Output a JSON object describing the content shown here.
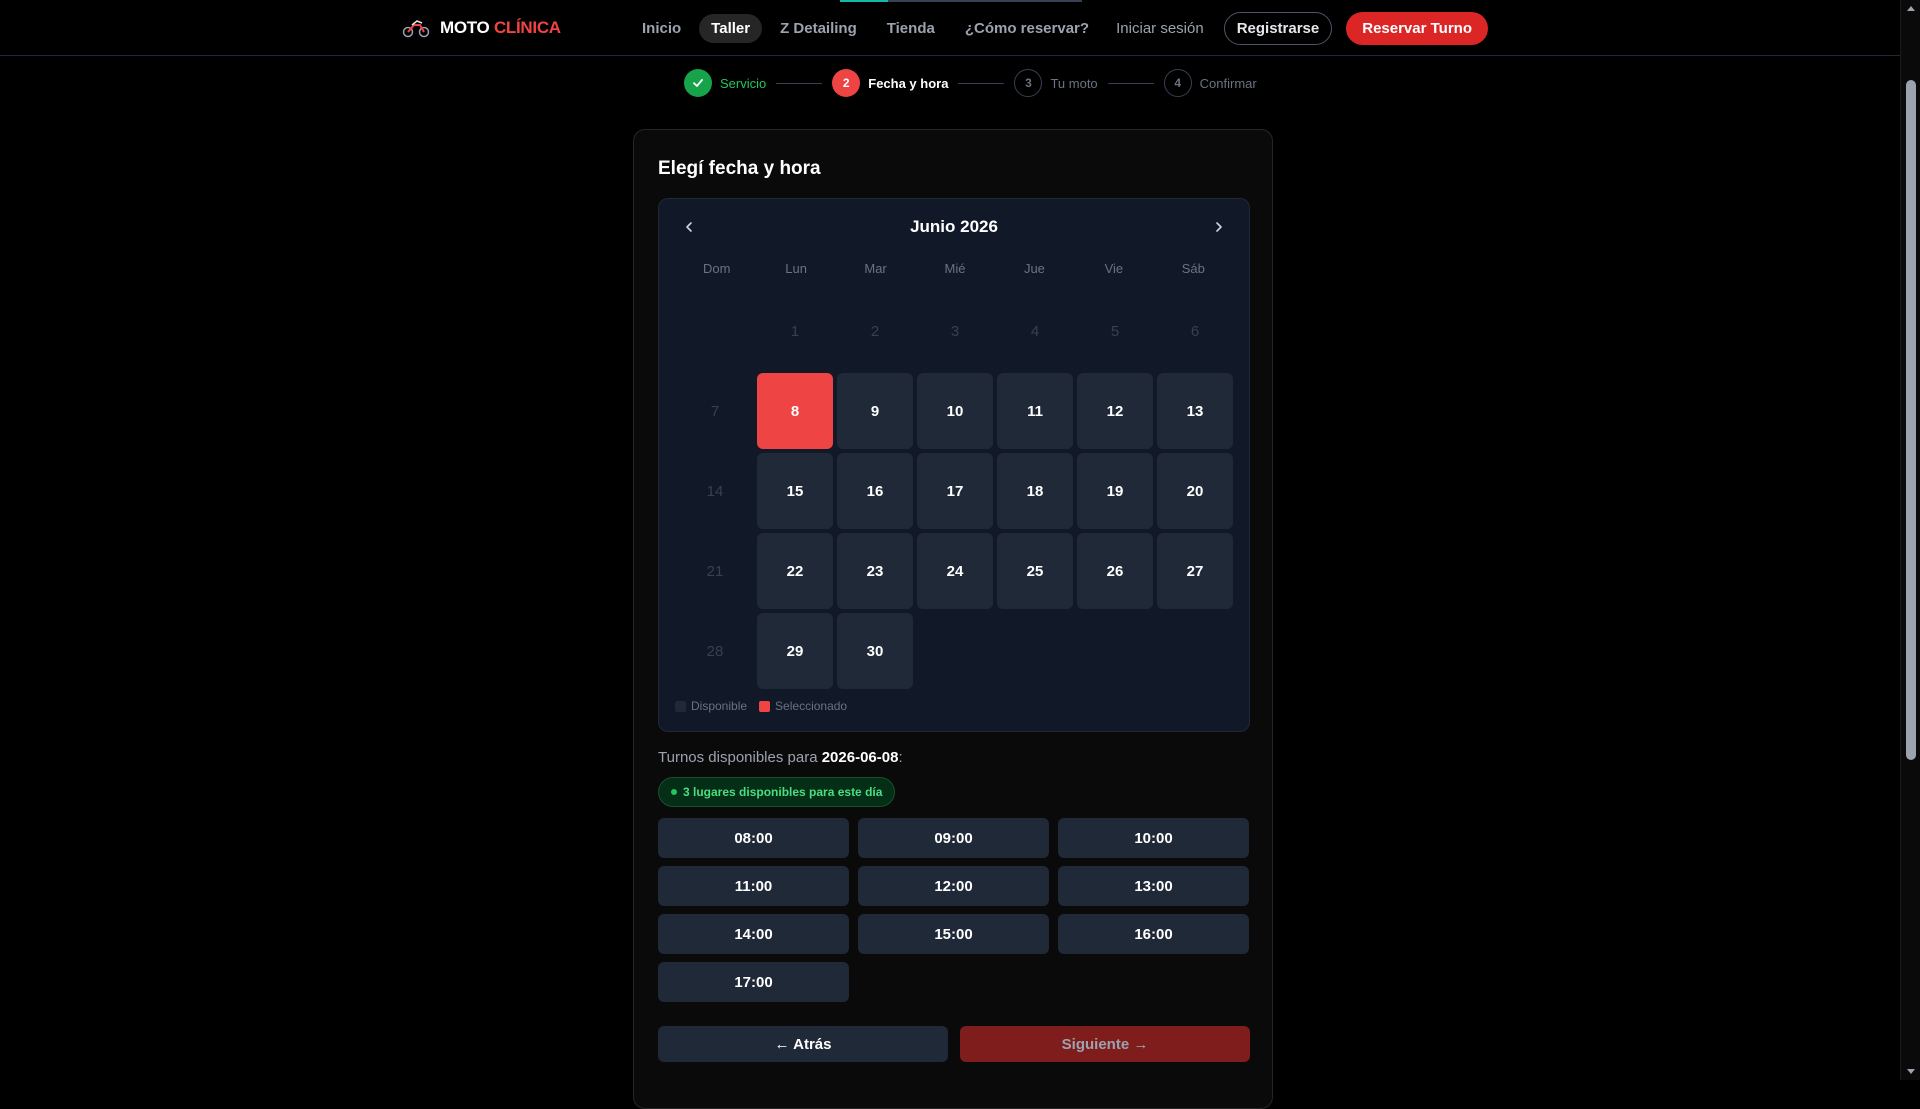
{
  "navbar": {
    "brand_part1": "MOTO",
    "brand_part2": "CLÍNICA",
    "links": [
      {
        "label": "Inicio",
        "active": false
      },
      {
        "label": "Taller",
        "active": true
      },
      {
        "label": "Z Detailing",
        "active": false
      },
      {
        "label": "Tienda",
        "active": false
      },
      {
        "label": "¿Cómo reservar?",
        "active": false
      }
    ],
    "login": "Iniciar sesión",
    "register": "Registrarse",
    "book": "Reservar Turno"
  },
  "stepper": {
    "steps": [
      {
        "number": "1",
        "label": "Servicio",
        "state": "done"
      },
      {
        "number": "2",
        "label": "Fecha y hora",
        "state": "current"
      },
      {
        "number": "3",
        "label": "Tu moto",
        "state": "todo"
      },
      {
        "number": "4",
        "label": "Confirmar",
        "state": "todo"
      }
    ]
  },
  "card": {
    "title": "Elegí fecha y hora"
  },
  "calendar": {
    "month_label": "Junio 2026",
    "weekdays": [
      "Dom",
      "Lun",
      "Mar",
      "Mié",
      "Jue",
      "Vie",
      "Sáb"
    ],
    "days": [
      {
        "label": "",
        "state": "empty"
      },
      {
        "label": "1",
        "state": "disabled"
      },
      {
        "label": "2",
        "state": "disabled"
      },
      {
        "label": "3",
        "state": "disabled"
      },
      {
        "label": "4",
        "state": "disabled"
      },
      {
        "label": "5",
        "state": "disabled"
      },
      {
        "label": "6",
        "state": "disabled"
      },
      {
        "label": "7",
        "state": "disabled"
      },
      {
        "label": "8",
        "state": "selected"
      },
      {
        "label": "9",
        "state": "available"
      },
      {
        "label": "10",
        "state": "available"
      },
      {
        "label": "11",
        "state": "available"
      },
      {
        "label": "12",
        "state": "available"
      },
      {
        "label": "13",
        "state": "available"
      },
      {
        "label": "14",
        "state": "disabled"
      },
      {
        "label": "15",
        "state": "available"
      },
      {
        "label": "16",
        "state": "available"
      },
      {
        "label": "17",
        "state": "available"
      },
      {
        "label": "18",
        "state": "available"
      },
      {
        "label": "19",
        "state": "available"
      },
      {
        "label": "20",
        "state": "available"
      },
      {
        "label": "21",
        "state": "disabled"
      },
      {
        "label": "22",
        "state": "available"
      },
      {
        "label": "23",
        "state": "available"
      },
      {
        "label": "24",
        "state": "available"
      },
      {
        "label": "25",
        "state": "available"
      },
      {
        "label": "26",
        "state": "available"
      },
      {
        "label": "27",
        "state": "available"
      },
      {
        "label": "28",
        "state": "disabled"
      },
      {
        "label": "29",
        "state": "available"
      },
      {
        "label": "30",
        "state": "available"
      }
    ],
    "legend": {
      "available": "Disponible",
      "selected": "Seleccionado"
    }
  },
  "slots": {
    "caption_prefix": "Turnos disponibles para",
    "date": "2026-06-08",
    "caption_suffix": ":",
    "availability": "3 lugares disponibles para este día",
    "times": [
      "08:00",
      "09:00",
      "10:00",
      "11:00",
      "12:00",
      "13:00",
      "14:00",
      "15:00",
      "16:00",
      "17:00"
    ]
  },
  "actions": {
    "back": "← Atrás",
    "next": "Siguiente →"
  },
  "colors": {
    "accent_red": "#ef4444",
    "success_green": "#22c55e",
    "surface": "#1f2937",
    "background": "#000000"
  }
}
